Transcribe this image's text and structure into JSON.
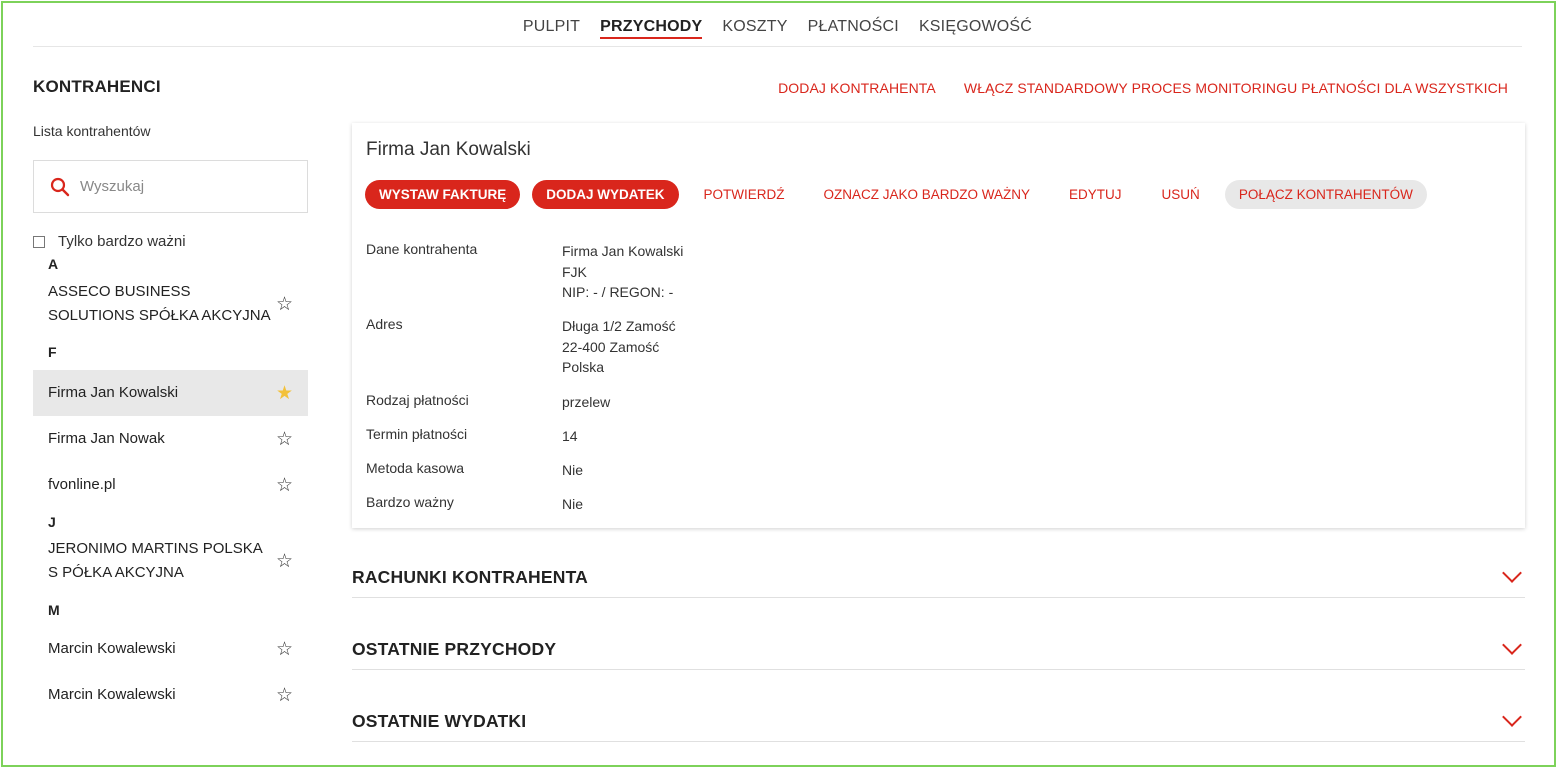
{
  "topnav": {
    "items": [
      {
        "label": "PULPIT"
      },
      {
        "label": "PRZYCHODY"
      },
      {
        "label": "KOSZTY"
      },
      {
        "label": "PŁATNOŚCI"
      },
      {
        "label": "KSIĘGOWOŚĆ"
      }
    ],
    "active": "PRZYCHODY"
  },
  "header": {
    "title": "KONTRAHENCI",
    "add_link": "DODAJ KONTRAHENTA",
    "monitoring_link": "WŁĄCZ STANDARDOWY PROCES MONITORINGU PŁATNOŚCI DLA WSZYSTKICH"
  },
  "sidebar": {
    "list_label": "Lista kontrahentów",
    "search_placeholder": "Wyszukaj",
    "filter_label": "Tylko bardzo ważni",
    "groups": [
      {
        "letter": "A",
        "items": [
          {
            "name": "ASSECO BUSINESS SOLUTIONS SPÓŁKA AKCYJNA",
            "starred": false
          }
        ]
      },
      {
        "letter": "F",
        "items": [
          {
            "name": "Firma Jan Kowalski",
            "starred": true,
            "selected": true
          },
          {
            "name": "Firma Jan Nowak",
            "starred": false
          },
          {
            "name": "fvonline.pl",
            "starred": false
          }
        ]
      },
      {
        "letter": "J",
        "items": [
          {
            "name": "JERONIMO MARTINS POLSKA S PÓŁKA AKCYJNA",
            "starred": false
          }
        ]
      },
      {
        "letter": "M",
        "items": [
          {
            "name": "Marcin Kowalewski",
            "starred": false
          },
          {
            "name": "Marcin Kowalewski",
            "starred": false
          }
        ]
      }
    ]
  },
  "detail": {
    "title": "Firma Jan Kowalski",
    "buttons": {
      "invoice": "WYSTAW FAKTURĘ",
      "expense": "DODAJ WYDATEK",
      "confirm": "POTWIERDŹ",
      "mark_important": "OZNACZ JAKO BARDZO WAŻNY",
      "edit": "EDYTUJ",
      "delete": "USUŃ",
      "merge": "POŁĄCZ KONTRAHENTÓW"
    },
    "fields": [
      {
        "key": "Dane kontrahenta",
        "lines": [
          "Firma Jan Kowalski",
          "FJK",
          "NIP: - / REGON: -"
        ]
      },
      {
        "key": "Adres",
        "lines": [
          "Długa 1/2 Zamość",
          "22-400 Zamość",
          "Polska"
        ]
      },
      {
        "key": "Rodzaj płatności",
        "lines": [
          "przelew"
        ]
      },
      {
        "key": "Termin płatności",
        "lines": [
          "14"
        ]
      },
      {
        "key": "Metoda kasowa",
        "lines": [
          "Nie"
        ]
      },
      {
        "key": "Bardzo ważny",
        "lines": [
          "Nie"
        ]
      }
    ]
  },
  "sections": [
    {
      "title": "RACHUNKI KONTRAHENTA"
    },
    {
      "title": "OSTATNIE PRZYCHODY"
    },
    {
      "title": "OSTATNIE WYDATKI"
    }
  ],
  "colors": {
    "accent": "#d9261c",
    "star_active": "#f3c13a",
    "frame": "#7dd25a"
  }
}
